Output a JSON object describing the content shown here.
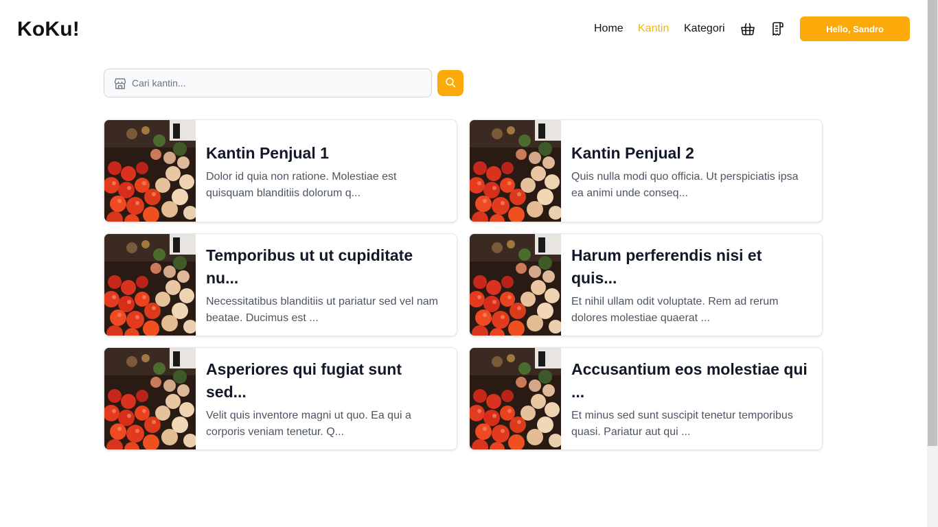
{
  "brand": {
    "logo": "KoKu!"
  },
  "nav": {
    "links": [
      {
        "label": "Home",
        "active": false
      },
      {
        "label": "Kantin",
        "active": true
      },
      {
        "label": "Kategori",
        "active": false
      }
    ],
    "icons": [
      "basket-icon",
      "receipt-icon"
    ],
    "user_button": "Hello, Sandro"
  },
  "search": {
    "placeholder": "Cari kantin...",
    "value": ""
  },
  "colors": {
    "accent": "#fbaa0a",
    "active_link": "#f5b20a",
    "text": "#111827",
    "muted": "#4b5563"
  },
  "kantin_list": [
    {
      "title": "Kantin Penjual 1",
      "description": "Dolor id quia non ratione. Molestiae est quisquam blanditiis dolorum q..."
    },
    {
      "title": "Kantin Penjual 2",
      "description": "Quis nulla modi quo officia. Ut perspiciatis ipsa ea animi unde conseq..."
    },
    {
      "title": "Temporibus ut ut cupiditate nu...",
      "description": "Necessitatibus blanditiis ut pariatur sed vel nam beatae. Ducimus est ..."
    },
    {
      "title": "Harum perferendis nisi et quis...",
      "description": "Et nihil ullam odit voluptate. Rem ad rerum dolores molestiae quaerat ..."
    },
    {
      "title": "Asperiores qui fugiat sunt sed...",
      "description": "Velit quis inventore magni ut quo. Ea qui a corporis veniam tenetur. Q..."
    },
    {
      "title": "Accusantium eos molestiae qui ...",
      "description": "Et minus sed sunt suscipit tenetur temporibus quasi. Pariatur aut qui ..."
    }
  ]
}
